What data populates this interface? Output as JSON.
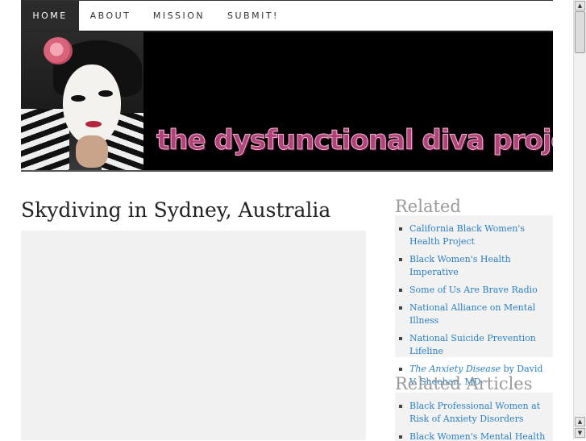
{
  "nav": {
    "items": [
      {
        "label": "HOME",
        "active": true
      },
      {
        "label": "ABOUT",
        "active": false
      },
      {
        "label": "MISSION",
        "active": false
      },
      {
        "label": "SUBMIT!",
        "active": false
      }
    ]
  },
  "banner": {
    "title": "the dysfunctional diva project"
  },
  "post": {
    "title": "Skydiving in Sydney, Australia"
  },
  "sidebar": {
    "resources": {
      "title": "Related Resources",
      "items": [
        {
          "label": "California Black Women's Health Project"
        },
        {
          "label": "Black Women's Health Imperative"
        },
        {
          "label": "Some of Us Are Brave Radio"
        },
        {
          "label": "National Alliance on Mental Illness"
        },
        {
          "label": "National Suicide Prevention Lifeline"
        },
        {
          "italic": "The Anxiety Disease",
          "rest": " by David V. Sheehan, MD"
        }
      ]
    },
    "articles": {
      "title": "Related Articles",
      "items": [
        {
          "label": "Black Professional Women at Risk of Anxiety Disorders"
        },
        {
          "label": "Black Women's Mental Health"
        }
      ]
    }
  },
  "scrollbar": {
    "up_arrow": "▲",
    "down_arrow": "▼"
  },
  "colors": {
    "link": "#2a7fc4",
    "nav_active_bg": "#2b2b2b",
    "banner_title": "#b0447a"
  }
}
